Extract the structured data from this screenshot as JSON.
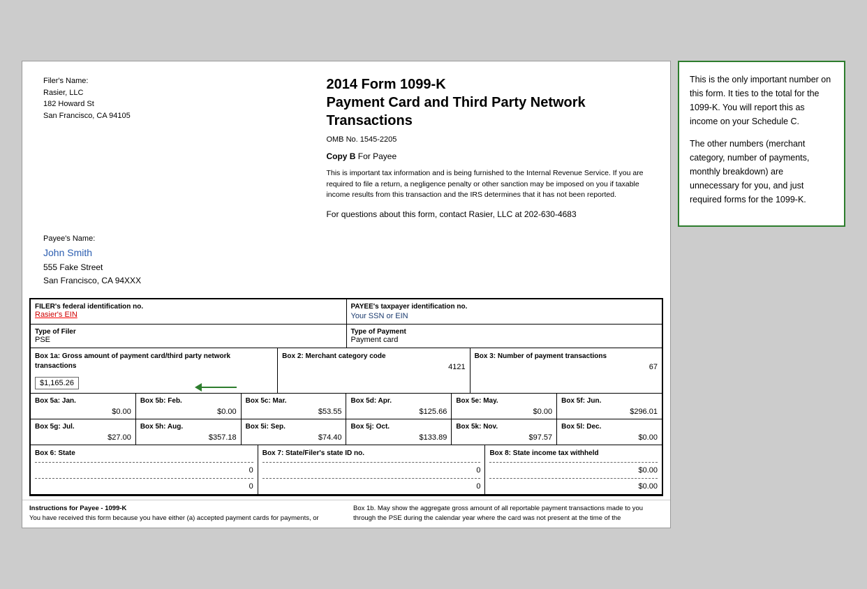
{
  "form": {
    "title": "2014 Form 1099-K",
    "subtitle": "Payment Card and Third Party Network Transactions",
    "omb": "OMB No. 1545-2205",
    "copy_b_label": "Copy B",
    "copy_b_suffix": " For Payee",
    "info_text": "This is important tax information and is being furnished to the Internal Revenue Service. If you are required to file a return, a negligence penalty or other sanction may be imposed on you if taxable income results from this transaction and the IRS determines that it has not been reported.",
    "contact_text": "For questions about this form, contact Rasier, LLC at 202-630-4683",
    "filer_name_label": "Filer's Name:",
    "filer_name": "Rasier, LLC",
    "filer_address": "182 Howard St",
    "filer_city": "San Francisco, CA 94105",
    "payee_label": "Payee's Name:",
    "payee_name": "John Smith",
    "payee_address": "555 Fake Street",
    "payee_city": "San Francisco, CA 94XXX",
    "filer_ein_label": "FILER's federal identification no.",
    "filer_ein_value": "Rasier's EIN",
    "payee_tin_label": "PAYEE's taxpayer identification no.",
    "payee_tin_value": "Your SSN or EIN",
    "type_of_filer_label": "Type of Filer",
    "type_of_filer_value": "PSE",
    "type_of_payment_label": "Type of Payment",
    "type_of_payment_value": "Payment card",
    "box1a_label": "Box 1a: Gross amount of payment card/third party network transactions",
    "box1a_value": "$1,165.26",
    "box2_label": "Box 2: Merchant category code",
    "box2_value": "4121",
    "box3_label": "Box 3: Number of payment transactions",
    "box3_value": "67",
    "box5a_label": "Box 5a: Jan.",
    "box5a_value": "$0.00",
    "box5b_label": "Box 5b: Feb.",
    "box5b_value": "$0.00",
    "box5c_label": "Box 5c: Mar.",
    "box5c_value": "$53.55",
    "box5d_label": "Box 5d: Apr.",
    "box5d_value": "$125.66",
    "box5e_label": "Box 5e: May.",
    "box5e_value": "$0.00",
    "box5f_label": "Box 5f: Jun.",
    "box5f_value": "$296.01",
    "box5g_label": "Box 5g: Jul.",
    "box5g_value": "$27.00",
    "box5h_label": "Box 5h: Aug.",
    "box5h_value": "$357.18",
    "box5i_label": "Box 5i: Sep.",
    "box5i_value": "$74.40",
    "box5j_label": "Box 5j: Oct.",
    "box5j_value": "$133.89",
    "box5k_label": "Box 5k: Nov.",
    "box5k_value": "$97.57",
    "box5l_label": "Box 5l: Dec.",
    "box5l_value": "$0.00",
    "box6_label": "Box 6: State",
    "box6_value1": "0",
    "box6_value2": "0",
    "box7_label": "Box 7: State/Filer's state ID no.",
    "box7_value1": "0",
    "box7_value2": "0",
    "box8_label": "Box 8: State income tax withheld",
    "box8_value1": "$0.00",
    "box8_value2": "$0.00",
    "footer_left_title": "Instructions for Payee - 1099-K",
    "footer_left_text": "You have received this form because you have either (a) accepted payment cards for payments, or",
    "footer_right_text": "Box 1b. May show the aggregate gross amount of all reportable payment transactions made to you through the PSE during the calendar year where the card was not present at the time of the"
  },
  "annotation": {
    "para1": "This is the only important number on this form. It ties to the total for the 1099-K. You will report this as income on your Schedule C.",
    "para2": "The other numbers (merchant category, number of payments, monthly breakdown) are unnecessary for you, and just required forms for the 1099-K."
  }
}
